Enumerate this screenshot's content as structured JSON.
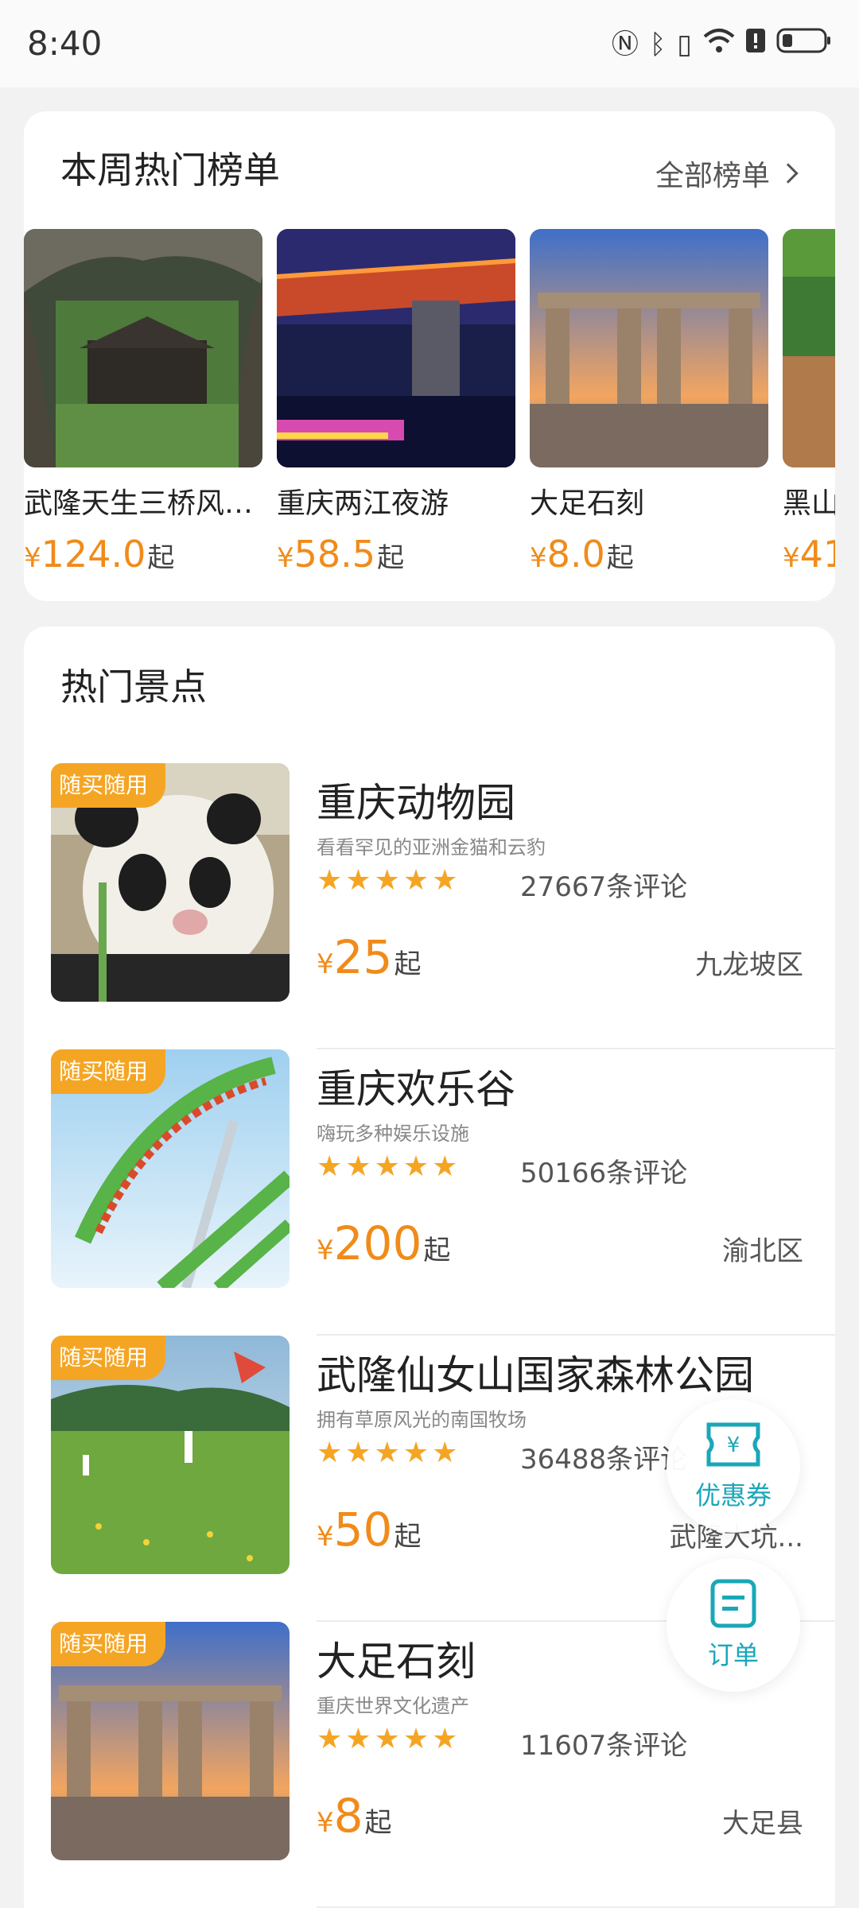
{
  "status": {
    "time": "8:40"
  },
  "rank": {
    "title": "本周热门榜单",
    "all_label": "全部榜单",
    "items": [
      {
        "name": "武隆天生三桥风…",
        "yen": "¥",
        "price": "124.0",
        "suffix": "起"
      },
      {
        "name": "重庆两江夜游",
        "yen": "¥",
        "price": "58.5",
        "suffix": "起"
      },
      {
        "name": "大足石刻",
        "yen": "¥",
        "price": "8.0",
        "suffix": "起"
      },
      {
        "name": "黑山",
        "yen": "¥",
        "price": "41",
        "suffix": ""
      }
    ]
  },
  "hot": {
    "title": "热门景点",
    "spots": [
      {
        "badge": "随买随用",
        "name": "重庆动物园",
        "desc": "看看罕见的亚洲金猫和云豹",
        "rating": 5,
        "reviews": "27667条评论",
        "yen": "¥",
        "price": "25",
        "suffix": "起",
        "area": "九龙坡区"
      },
      {
        "badge": "随买随用",
        "name": "重庆欢乐谷",
        "desc": "嗨玩多种娱乐设施",
        "rating": 5,
        "reviews": "50166条评论",
        "yen": "¥",
        "price": "200",
        "suffix": "起",
        "area": "渝北区"
      },
      {
        "badge": "随买随用",
        "name": "武隆仙女山国家森林公园",
        "desc": "拥有草原风光的南国牧场",
        "rating": 5,
        "reviews": "36488条评论",
        "yen": "¥",
        "price": "50",
        "suffix": "起",
        "area": "武隆大坑..."
      },
      {
        "badge": "随买随用",
        "name": "大足石刻",
        "desc": "重庆世界文化遗产",
        "rating": 5,
        "reviews": "11607条评论",
        "yen": "¥",
        "price": "8",
        "suffix": "起",
        "area": "大足县"
      }
    ]
  },
  "floating": {
    "coupon_label": "优惠券",
    "order_label": "订单"
  },
  "colors": {
    "accent": "#f08b1a",
    "badge": "#f5a524",
    "teal": "#1aa7b8"
  }
}
